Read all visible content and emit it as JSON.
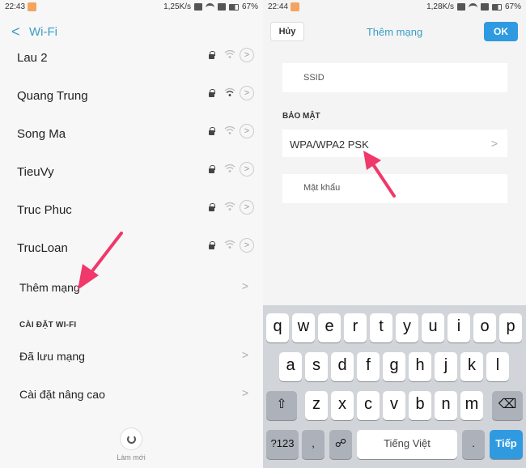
{
  "left": {
    "statusbar": {
      "time": "22:43",
      "speed": "1,25K/s",
      "battery": "67%"
    },
    "header": {
      "back": "<",
      "title": "Wi-Fi"
    },
    "networks": [
      {
        "name": "Lau 2"
      },
      {
        "name": "Quang Trung"
      },
      {
        "name": "Song Ma"
      },
      {
        "name": "TieuVy"
      },
      {
        "name": "Truc Phuc"
      },
      {
        "name": "TrucLoan"
      }
    ],
    "add_network": "Thêm mạng",
    "section_title": "CÀI ĐẶT WI-FI",
    "saved_networks": "Đã lưu mạng",
    "advanced": "Cài đặt nâng cao",
    "refresh_label": "Làm mới"
  },
  "right": {
    "statusbar": {
      "time": "22:44",
      "speed": "1,28K/s",
      "battery": "67%"
    },
    "header": {
      "cancel": "Hủy",
      "title": "Thêm mạng",
      "ok": "OK"
    },
    "ssid_label": "SSID",
    "security_section": "BẢO MẬT",
    "security_value": "WPA/WPA2 PSK",
    "password_label": "Mật khẩu",
    "keyboard": {
      "row1": [
        "q",
        "w",
        "e",
        "r",
        "t",
        "y",
        "u",
        "i",
        "o",
        "p"
      ],
      "row2": [
        "a",
        "s",
        "d",
        "f",
        "g",
        "h",
        "j",
        "k",
        "l"
      ],
      "row3": [
        "z",
        "x",
        "c",
        "v",
        "b",
        "n",
        "m"
      ],
      "numbers": "?123",
      "comma": ",",
      "space": "Tiếng Việt",
      "period": ".",
      "return": "Tiếp"
    }
  },
  "colors": {
    "accent": "#3a9dc6",
    "ok_button": "#2f9ae0",
    "arrow": "#f0386b"
  }
}
